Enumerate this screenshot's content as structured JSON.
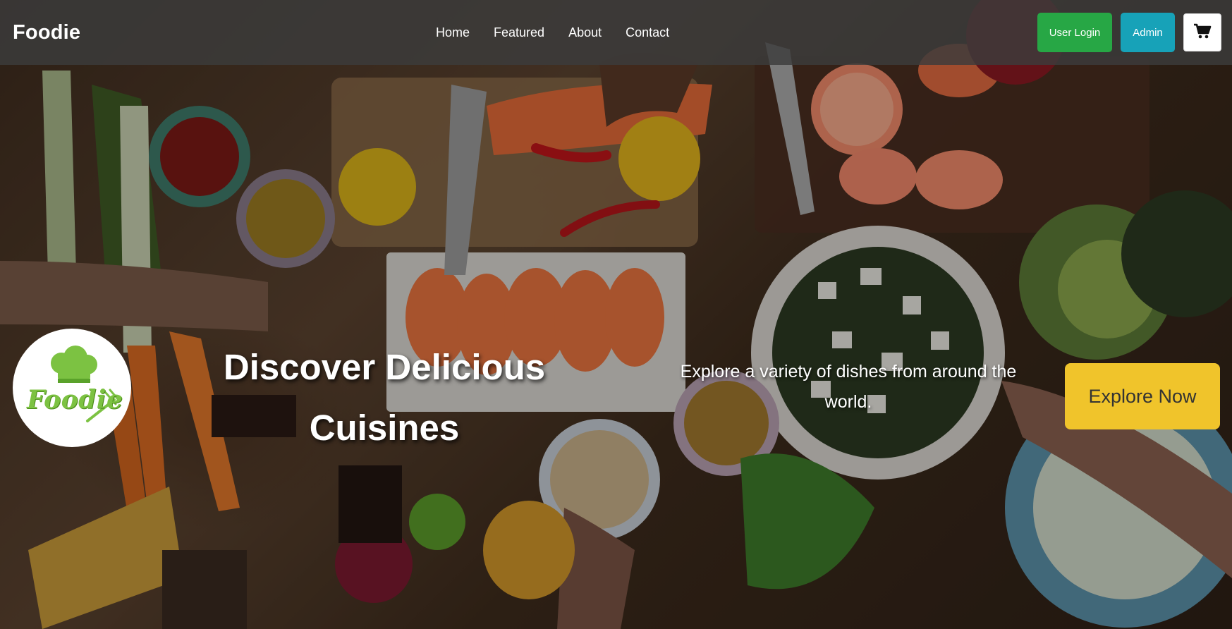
{
  "navbar": {
    "brand": "Foodie",
    "links": [
      "Home",
      "Featured",
      "About",
      "Contact"
    ],
    "user_login_label": "User Login",
    "admin_label": "Admin"
  },
  "hero": {
    "logo_text": "Foodie",
    "title": "Discover Delicious Cuisines",
    "subtitle": "Explore a variety of dishes from around the world.",
    "cta_label": "Explore Now"
  },
  "colors": {
    "navbar_bg": "#3c3c3c",
    "login_button": "#27a745",
    "admin_button": "#17a2b8",
    "cta_button": "#f0c42b",
    "logo_green": "#7cc242"
  },
  "icons": [
    "cart-icon",
    "chef-hat-icon"
  ]
}
